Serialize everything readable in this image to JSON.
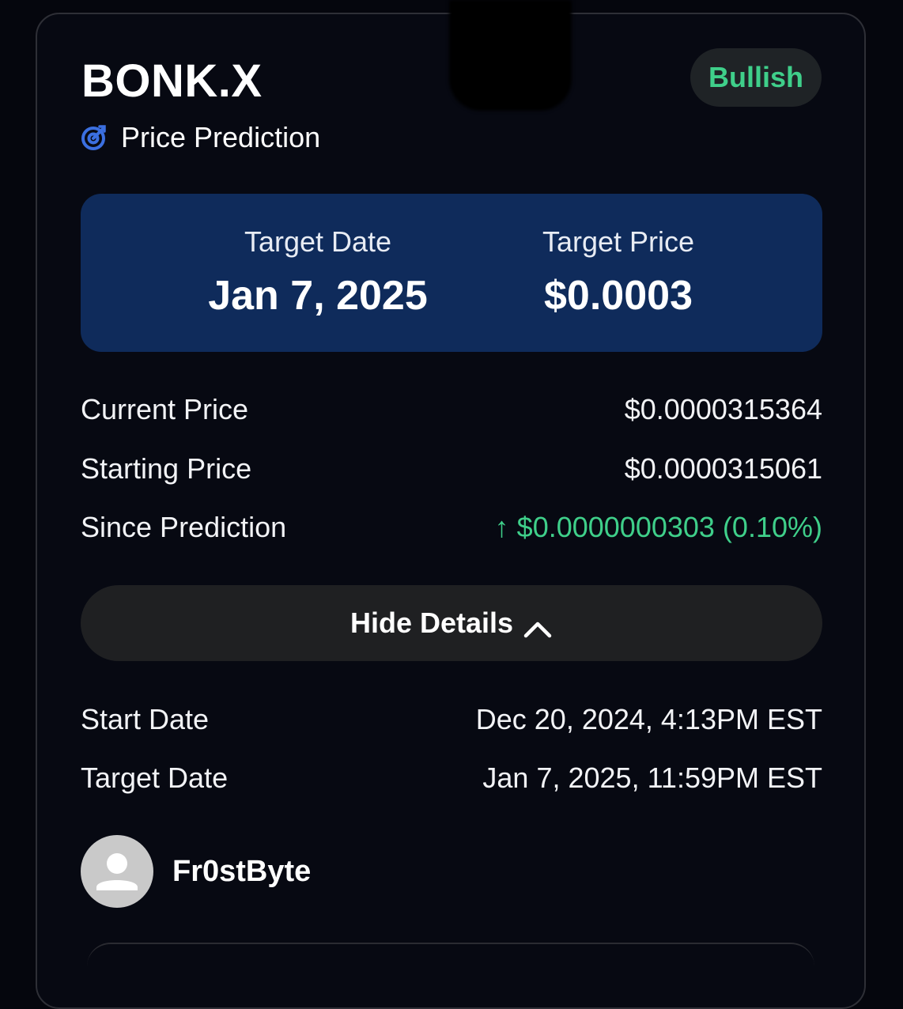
{
  "header": {
    "title": "BONK.X",
    "subtitle": "Price Prediction",
    "subtitle_icon": "target-icon",
    "badge": "Bullish"
  },
  "target": {
    "date_label": "Target Date",
    "date_value": "Jan 7, 2025",
    "price_label": "Target Price",
    "price_value": "$0.0003"
  },
  "prices": {
    "current_label": "Current Price",
    "current_value": "$0.0000315364",
    "starting_label": "Starting Price",
    "starting_value": "$0.0000315061",
    "since_label": "Since Prediction",
    "since_value": "↑ $0.0000000303 (0.10%)"
  },
  "toggle": {
    "label": "Hide Details",
    "icon": "chevron-up-icon"
  },
  "details": {
    "start_label": "Start Date",
    "start_value": "Dec 20, 2024, 4:13PM EST",
    "target_label": "Target Date",
    "target_value": "Jan 7, 2025, 11:59PM EST"
  },
  "user": {
    "name": "Fr0stByte",
    "avatar_icon": "person-icon"
  },
  "colors": {
    "background": "#05060d",
    "accent_green": "#3fcf8a",
    "target_box": "#0f2b5b",
    "icon_blue": "#3b6fe0"
  }
}
